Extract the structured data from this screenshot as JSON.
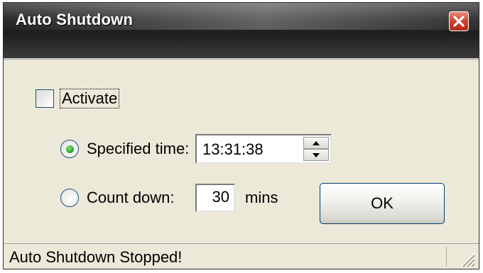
{
  "window": {
    "title": "Auto Shutdown"
  },
  "icons": {
    "close": "close-icon",
    "spin_up": "chevron-up-icon",
    "spin_down": "chevron-down-icon",
    "grip": "resize-grip-icon"
  },
  "activate": {
    "label": "Activate",
    "checked": false
  },
  "specified_time": {
    "label": "Specified time:",
    "selected": true,
    "value": "13:31:38"
  },
  "count_down": {
    "label": "Count down:",
    "selected": false,
    "value": "30",
    "unit": "mins"
  },
  "buttons": {
    "ok_label": "OK"
  },
  "status": {
    "text": "Auto Shutdown Stopped!"
  },
  "colors": {
    "titlebar": "#1e1e1e",
    "close_button": "#d2422f",
    "dialog_background": "#ece9d8",
    "radio_selected": "#21a121"
  }
}
